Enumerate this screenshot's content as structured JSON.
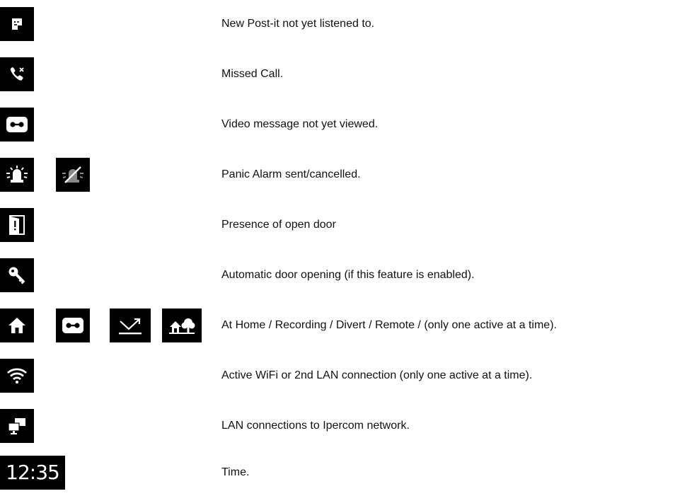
{
  "colors": {
    "icon_background": "#000000",
    "icon_foreground": "#ffffff",
    "text": "#111111"
  },
  "legend": [
    {
      "icons": [
        "post-it-icon"
      ],
      "description": "New Post-it not yet listened to."
    },
    {
      "icons": [
        "missed-call-icon"
      ],
      "description": "Missed Call."
    },
    {
      "icons": [
        "voicemail-icon"
      ],
      "description": "Video message not yet viewed."
    },
    {
      "icons": [
        "panic-alarm-icon",
        "panic-alarm-cancelled-icon"
      ],
      "description": "Panic Alarm sent/cancelled."
    },
    {
      "icons": [
        "open-door-icon"
      ],
      "description": "Presence of open door"
    },
    {
      "icons": [
        "key-icon"
      ],
      "description": "Automatic door opening (if this feature is enabled)."
    },
    {
      "icons": [
        "home-icon",
        "recording-icon",
        "divert-icon",
        "remote-icon"
      ],
      "description": "At Home / Recording / Divert / Remote / (only one active at a time)."
    },
    {
      "icons": [
        "wifi-icon"
      ],
      "description": "Active WiFi or 2nd LAN connection (only one active at a time)."
    },
    {
      "icons": [
        "lan-icon"
      ],
      "description": "LAN connections to Ipercom network."
    },
    {
      "time_display": "12:35",
      "description": "Time."
    }
  ]
}
